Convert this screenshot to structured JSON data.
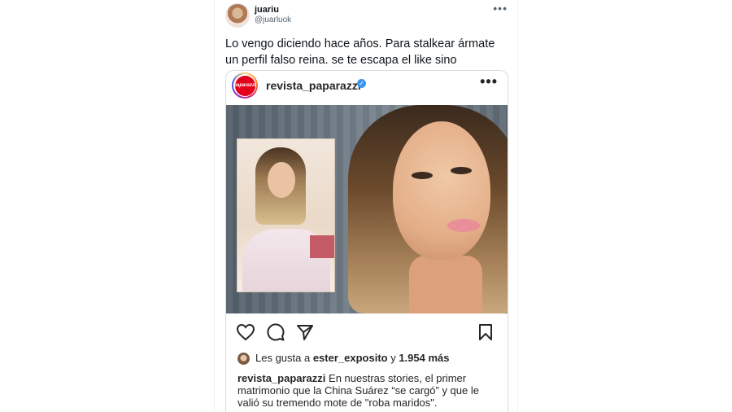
{
  "tweet": {
    "author_name": "juariu",
    "author_handle": "@juarluok",
    "more_label": "•••",
    "text": "Lo vengo diciendo hace años. Para stalkear ármate un perfil falso reina. se te escapa el like sino"
  },
  "instagram": {
    "avatar_logo": "paparazzi",
    "username": "revista_paparazzi",
    "verified_mark": "✓",
    "more_label": "•••",
    "actions": {
      "like_icon": "heart-icon",
      "comment_icon": "comment-icon",
      "share_icon": "send-icon",
      "save_icon": "bookmark-icon"
    },
    "likes": {
      "prefix": "Les gusta a ",
      "user": "ester_exposito",
      "middle": " y ",
      "count": "1.954 más"
    },
    "caption": {
      "username": "revista_paparazzi",
      "text": " En nuestras stories, el primer matrimonio que la China Suárez “se cargó” y que le valió su tremendo mote de \"roba maridos\"."
    }
  }
}
